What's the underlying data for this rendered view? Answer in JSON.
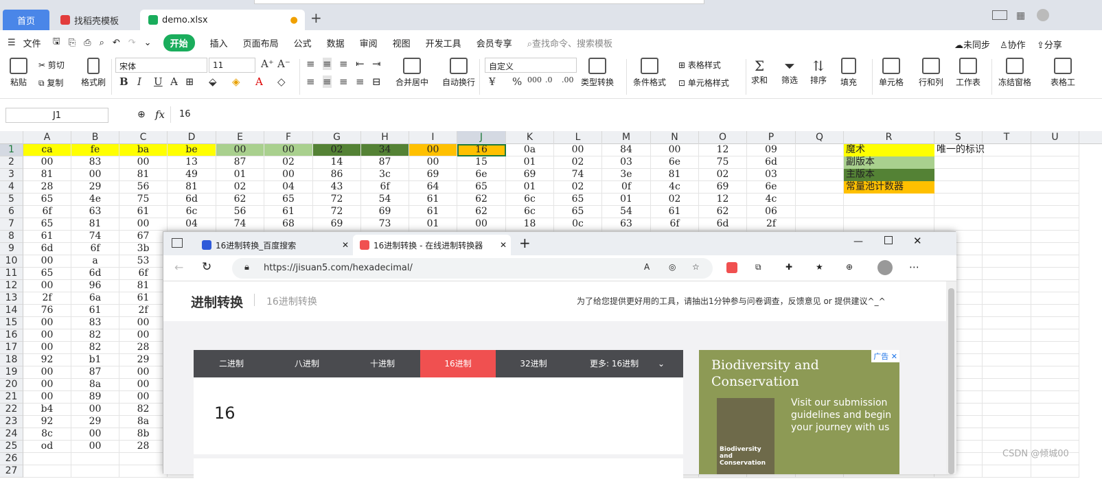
{
  "titlebar": {
    "tab_home": "首页",
    "tab_template": "找稻壳模板",
    "tab_file": "demo.xlsx"
  },
  "menubar": {
    "file": "文件",
    "items": [
      "开始",
      "插入",
      "页面布局",
      "公式",
      "数据",
      "审阅",
      "视图",
      "开发工具",
      "会员专享"
    ],
    "search": "查找命令、搜索模板",
    "sync": "未同步",
    "collab": "协作",
    "share": "分享"
  },
  "ribbon": {
    "paste": "粘贴",
    "cut": "剪切",
    "copy": "复制",
    "format_painter": "格式刷",
    "font": "宋体",
    "size": "11",
    "bold": "B",
    "italic": "I",
    "underline": "U",
    "merge": "合并居中",
    "wrap": "自动换行",
    "number_format": "自定义",
    "type_convert": "类型转换",
    "cond_format": "条件格式",
    "table_style": "表格样式",
    "cell_style": "单元格样式",
    "sum": "求和",
    "filter": "筛选",
    "sort": "排序",
    "fill": "填充",
    "cell": "单元格",
    "rowcol": "行和列",
    "sheet": "工作表",
    "freeze": "冻结窗格",
    "tools": "表格工"
  },
  "formula": {
    "name_box": "J1",
    "fx": "fx",
    "value": "16"
  },
  "columns": [
    "A",
    "B",
    "C",
    "D",
    "E",
    "F",
    "G",
    "H",
    "I",
    "J",
    "K",
    "L",
    "M",
    "N",
    "O",
    "P",
    "Q",
    "R",
    "S",
    "T",
    "U"
  ],
  "rows": [
    [
      "ca",
      "fe",
      "ba",
      "be",
      "00",
      "00",
      "02",
      "34",
      "00",
      "16",
      "0a",
      "00",
      "84",
      "00",
      "12",
      "09"
    ],
    [
      "00",
      "83",
      "00",
      "13",
      "87",
      "02",
      "14",
      "87",
      "00",
      "15",
      "01",
      "02",
      "03",
      "6e",
      "75",
      "6d"
    ],
    [
      "81",
      "00",
      "81",
      "49",
      "01",
      "00",
      "86",
      "3c",
      "69",
      "6e",
      "69",
      "74",
      "3e",
      "81",
      "02",
      "03"
    ],
    [
      "28",
      "29",
      "56",
      "81",
      "02",
      "04",
      "43",
      "6f",
      "64",
      "65",
      "01",
      "02",
      "0f",
      "4c",
      "69",
      "6e"
    ],
    [
      "65",
      "4e",
      "75",
      "6d",
      "62",
      "65",
      "72",
      "54",
      "61",
      "62",
      "6c",
      "65",
      "01",
      "02",
      "12",
      "4c"
    ],
    [
      "6f",
      "63",
      "61",
      "6c",
      "56",
      "61",
      "72",
      "69",
      "61",
      "62",
      "6c",
      "65",
      "54",
      "61",
      "62",
      "06"
    ],
    [
      "65",
      "81",
      "00",
      "04",
      "74",
      "68",
      "69",
      "73",
      "01",
      "00",
      "18",
      "0c",
      "63",
      "6f",
      "6d",
      "2f"
    ],
    [
      "61",
      "74",
      "67"
    ],
    [
      "6d",
      "6f",
      "3b"
    ],
    [
      "00",
      "a",
      "53"
    ],
    [
      "65",
      "6d",
      "6f"
    ],
    [
      "00",
      "96",
      "81"
    ],
    [
      "2f",
      "6a",
      "61"
    ],
    [
      "76",
      "61",
      "2f"
    ],
    [
      "00",
      "83",
      "00"
    ],
    [
      "00",
      "82",
      "00"
    ],
    [
      "00",
      "82",
      "28"
    ],
    [
      "92",
      "b1",
      "29"
    ],
    [
      "00",
      "87",
      "00"
    ],
    [
      "00",
      "8a",
      "00"
    ],
    [
      "00",
      "89",
      "00"
    ],
    [
      "b4",
      "00",
      "82"
    ],
    [
      "92",
      "29",
      "8a"
    ],
    [
      "8c",
      "00",
      "8b"
    ],
    [
      "od",
      "00",
      "28"
    ],
    [],
    []
  ],
  "legend": [
    {
      "label": "魔术",
      "color": "#ffff00"
    },
    {
      "label": "副版本",
      "color": "#a9d08e"
    },
    {
      "label": "主版本",
      "color": "#548235"
    },
    {
      "label": "常量池计数器",
      "color": "#ffc000"
    }
  ],
  "legend_note": "唯一的标识",
  "browser": {
    "tab1": "16进制转换_百度搜索",
    "tab2": "16进制转换 - 在线进制转换器",
    "url": "https://jisuan5.com/hexadecimal/",
    "site_logo": "进制转换",
    "site_sub": "16进制转换",
    "notice": "为了给您提供更好用的工具，请抽出1分钟参与问卷调查，反馈意见 or 提供建议^_^",
    "conv_tabs": [
      "二进制",
      "八进制",
      "十进制",
      "16进制",
      "32进制"
    ],
    "more_label": "更多:",
    "more_value": "16进制",
    "input_value": "16",
    "ad_tag": "广告",
    "ad_title": "Biodiversity and Conservation",
    "ad_text": "Visit our submission guidelines and begin your journey with us",
    "ad_book": "Biodiversity and Conservation"
  },
  "watermark": "CSDN @倾城00",
  "colors": {
    "magic": "#ffff00",
    "minor": "#a9d08e",
    "major": "#548235",
    "pool": "#ffc000",
    "accent": "#1aad5c",
    "active_tab": "#f05050"
  }
}
